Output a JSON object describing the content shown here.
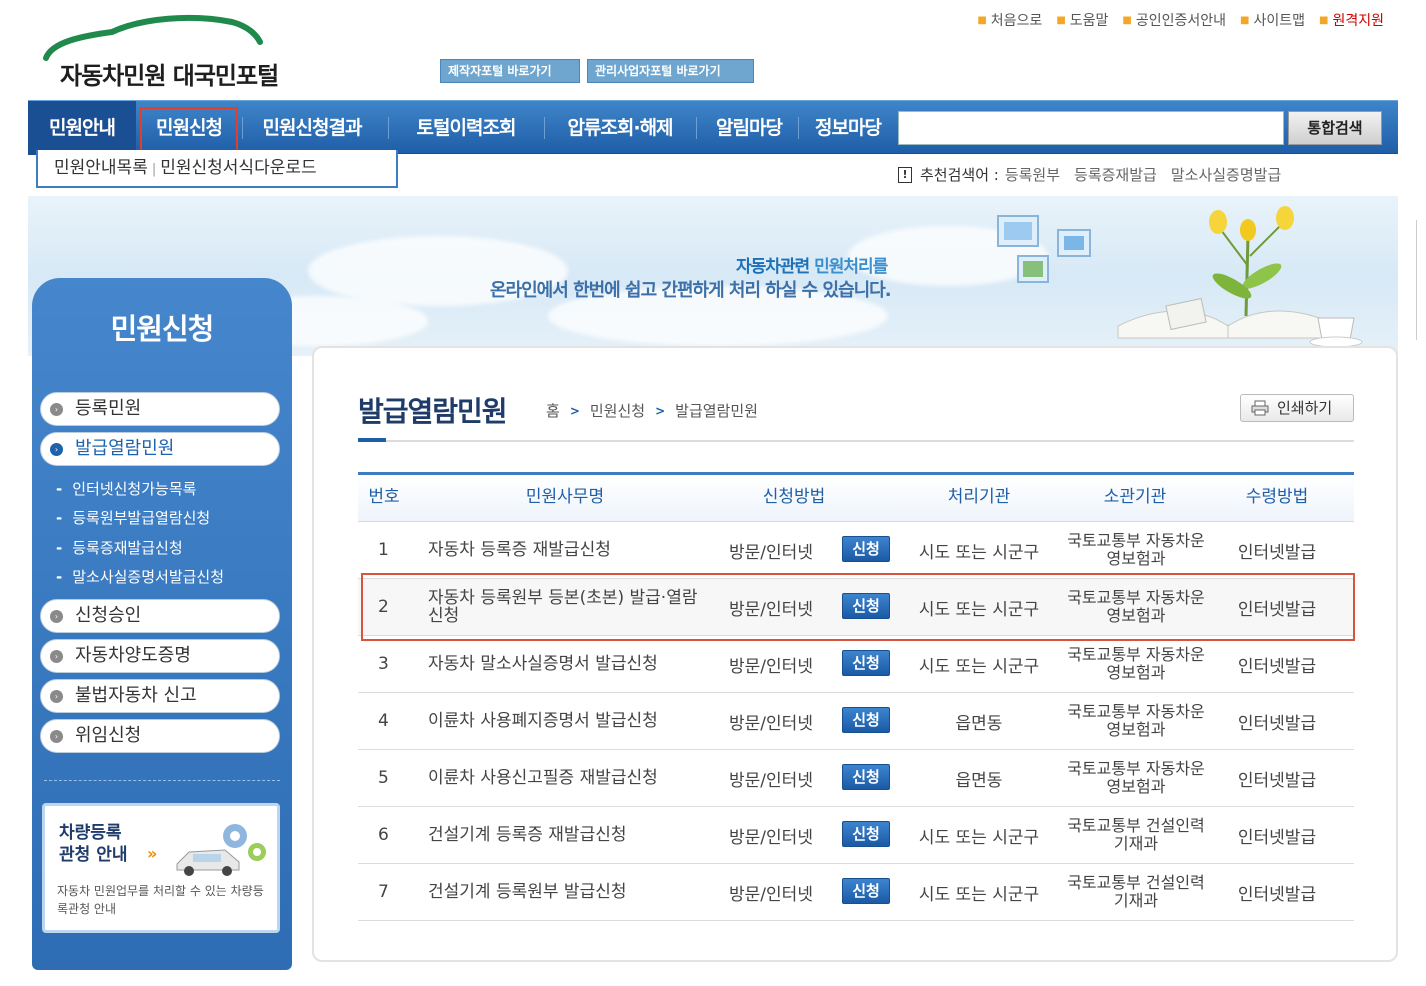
{
  "header": {
    "logo_text": "자동차민원 대국민포털",
    "portal_buttons": [
      "제작자포털 바로가기",
      "관리사업자포털 바로가기"
    ],
    "util_links": [
      "처음으로",
      "도움말",
      "공인인증서안내",
      "사이트맵"
    ],
    "remote_link": "원격지원"
  },
  "gnb": {
    "items": [
      "민원안내",
      "민원신청",
      "민원신청결과",
      "토털이력조회",
      "압류조회·해제",
      "알림마당",
      "정보마당"
    ],
    "search_placeholder": "",
    "search_button": "통합검색"
  },
  "subnav": {
    "items": [
      "민원안내목록",
      "민원신청서식다운로드"
    ]
  },
  "recommend": {
    "label": "추천검색어 :",
    "keywords": [
      "등록원부",
      "등록증재발급",
      "말소사실증명발급"
    ]
  },
  "banner": {
    "line1_highlight": "자동차관련",
    "line1_rest": " 민원처리를",
    "line2": "온라인에서 한번에 쉽고 간편하게 처리 하실 수 있습니다."
  },
  "lnb": {
    "title": "민원신청",
    "items": [
      "등록민원",
      "발급열람민원",
      "신청승인",
      "자동차양도증명",
      "불법자동차 신고",
      "위임신청"
    ],
    "sub_items": [
      "인터넷신청가능목록",
      "등록원부발급열람신청",
      "등록증재발급신청",
      "말소사실증명서발급신청"
    ],
    "box_title": "차량등록\n관청 안내",
    "box_arrow": "»",
    "box_desc": "자동차 민원업무를 처리할 수 있는 차량등록관청 안내"
  },
  "content": {
    "title": "발급열람민원",
    "breadcrumb": [
      "홈",
      "민원신청",
      "발급열람민원"
    ],
    "print_button": "인쇄하기",
    "table": {
      "headers": [
        "번호",
        "민원사무명",
        "신청방법",
        "처리기관",
        "소관기관",
        "수령방법"
      ],
      "apply_label": "신청",
      "rows": [
        {
          "no": "1",
          "name": "자동차 등록증 재발급신청",
          "method": "방문/인터넷",
          "proc": "시도 또는 시군구",
          "agency": "국토교통부 자동차운영보험과",
          "receive": "인터넷발급"
        },
        {
          "no": "2",
          "name": "자동차 등록원부 등본(초본) 발급·열람신청",
          "method": "방문/인터넷",
          "proc": "시도 또는 시군구",
          "agency": "국토교통부 자동차운영보험과",
          "receive": "인터넷발급"
        },
        {
          "no": "3",
          "name": "자동차 말소사실증명서 발급신청",
          "method": "방문/인터넷",
          "proc": "시도 또는 시군구",
          "agency": "국토교통부 자동차운영보험과",
          "receive": "인터넷발급"
        },
        {
          "no": "4",
          "name": "이륜차 사용폐지증명서 발급신청",
          "method": "방문/인터넷",
          "proc": "읍면동",
          "agency": "국토교통부 자동차운영보험과",
          "receive": "인터넷발급"
        },
        {
          "no": "5",
          "name": "이륜차 사용신고필증 재발급신청",
          "method": "방문/인터넷",
          "proc": "읍면동",
          "agency": "국토교통부 자동차운영보험과",
          "receive": "인터넷발급"
        },
        {
          "no": "6",
          "name": "건설기계 등록증 재발급신청",
          "method": "방문/인터넷",
          "proc": "시도 또는 시군구",
          "agency": "국토교통부 건설인력기재과",
          "receive": "인터넷발급"
        },
        {
          "no": "7",
          "name": "건설기계 등록원부 발급신청",
          "method": "방문/인터넷",
          "proc": "시도 또는 시군구",
          "agency": "국토교통부 건설인력기재과",
          "receive": "인터넷발급"
        }
      ]
    }
  }
}
